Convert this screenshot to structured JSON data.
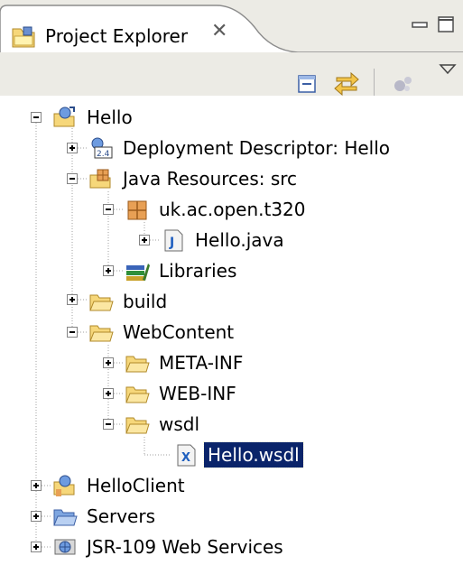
{
  "tab": {
    "title": "Project Explorer",
    "close_glyph": "⊘"
  },
  "toolbar": {
    "collapse_all": "collapse-all-icon",
    "link_with_editor": "link-with-editor-icon",
    "menu": "view-menu-icon"
  },
  "tree": {
    "hello": "Hello",
    "deployment_descriptor": "Deployment Descriptor: Hello",
    "java_resources": "Java Resources: src",
    "package": "uk.ac.open.t320",
    "hello_java": "Hello.java",
    "libraries": "Libraries",
    "build": "build",
    "webcontent": "WebContent",
    "meta_inf": "META-INF",
    "web_inf": "WEB-INF",
    "wsdl": "wsdl",
    "hello_wsdl": "Hello.wsdl",
    "helloclient": "HelloClient",
    "servers": "Servers",
    "jsr109": "JSR-109 Web Services"
  },
  "colors": {
    "selection": "#0a246a",
    "folder": "#f6d77a",
    "chrome": "#ecebe5"
  }
}
